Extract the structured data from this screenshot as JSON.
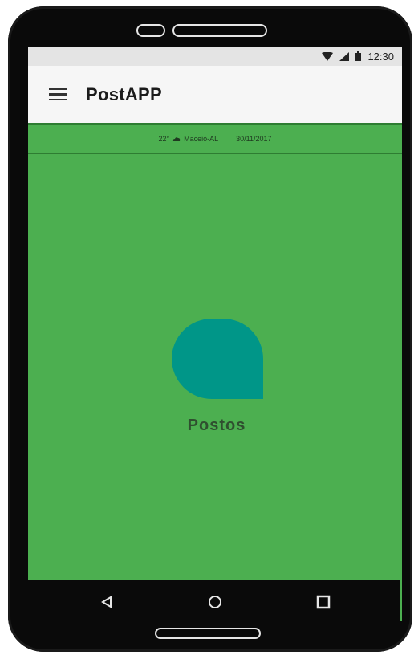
{
  "status_bar": {
    "time": "12:30",
    "icons": [
      "wifi-icon",
      "signal-icon",
      "battery-icon"
    ]
  },
  "app_bar": {
    "title": "PostAPP",
    "menu_icon": "hamburger-menu-icon"
  },
  "info_bar": {
    "temperature": "22°",
    "weather_icon": "cloud-icon",
    "location": "Maceió-AL",
    "date": "30/11/2017"
  },
  "main": {
    "card_label": "Postos",
    "card_color": "#009688"
  },
  "nav_bar": {
    "icons": [
      "back-icon",
      "home-icon",
      "recents-icon"
    ]
  },
  "colors": {
    "primary": "#4caf50",
    "primary_dark": "#2e7d32",
    "accent": "#009688"
  }
}
